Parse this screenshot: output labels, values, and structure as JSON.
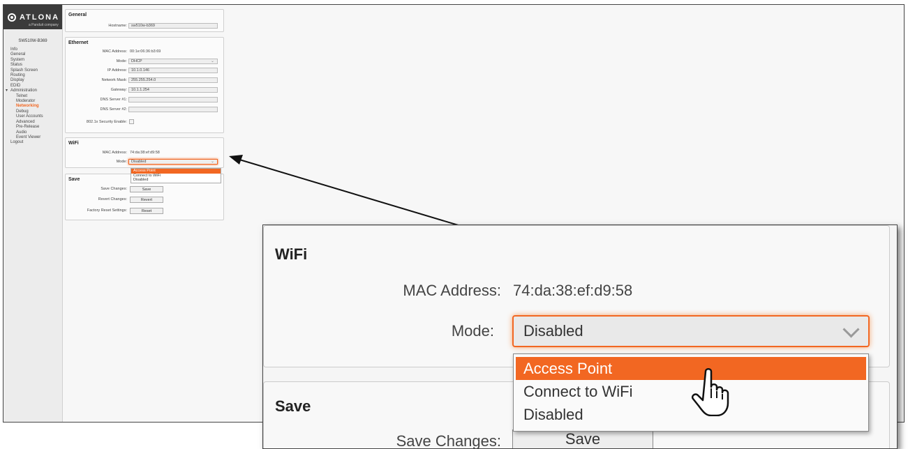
{
  "sidebar": {
    "logo_text": "ATLONA",
    "logo_sub": "a Panduit company",
    "device_name": "SW510W-B369",
    "items": [
      {
        "label": "Info",
        "level": 0
      },
      {
        "label": "General",
        "level": 0
      },
      {
        "label": "System",
        "level": 0
      },
      {
        "label": "Status",
        "level": 0
      },
      {
        "label": "Splash Screen",
        "level": 0
      },
      {
        "label": "Routing",
        "level": 0
      },
      {
        "label": "Display",
        "level": 0
      },
      {
        "label": "EDID",
        "level": 0
      },
      {
        "label": "Administration",
        "level": 0
      },
      {
        "label": "Telnet",
        "level": 1
      },
      {
        "label": "Moderator",
        "level": 1
      },
      {
        "label": "Networking",
        "level": 1,
        "active": true
      },
      {
        "label": "Debug",
        "level": 1
      },
      {
        "label": "User Accounts",
        "level": 1
      },
      {
        "label": "Advanced",
        "level": 1
      },
      {
        "label": "Pre-Release",
        "level": 1
      },
      {
        "label": "Audio",
        "level": 1
      },
      {
        "label": "Event Viewer",
        "level": 1
      },
      {
        "label": "Logout",
        "level": 0
      }
    ]
  },
  "general": {
    "title": "General",
    "hostname_label": "Hostname:",
    "hostname_value": "sw510w-b369"
  },
  "ethernet": {
    "title": "Ethernet",
    "mac_label": "MAC Address:",
    "mac_value": "00:1e:06:36:b3:69",
    "mode_label": "Mode:",
    "mode_value": "DHCP",
    "ip_label": "IP Address:",
    "ip_value": "10.1.0.146",
    "mask_label": "Network Mask:",
    "mask_value": "255.255.254.0",
    "gateway_label": "Gateway:",
    "gateway_value": "10.1.1.254",
    "dns1_label": "DNS Server #1:",
    "dns1_value": "",
    "dns2_label": "DNS Server #2:",
    "dns2_value": "",
    "security_label": "802.1x Security Enable:"
  },
  "wifi": {
    "title": "WiFi",
    "mac_label": "MAC Address:",
    "mac_value": "74:da:38:ef:d9:58",
    "mode_label": "Mode:",
    "mode_value": "Disabled",
    "options": [
      "Access Point",
      "Connect to WiFi",
      "Disabled"
    ],
    "highlighted_option": "Access Point"
  },
  "save": {
    "title": "Save",
    "save_label": "Save Changes:",
    "save_button": "Save",
    "revert_label": "Revert Changes:",
    "revert_button": "Revert",
    "reset_label": "Factory Reset Settings:",
    "reset_button": "Reset"
  },
  "zoom": {
    "wifi_title": "WiFi",
    "mac_label": "MAC Address:",
    "mac_value": "74:da:38:ef:d9:58",
    "mode_label": "Mode:",
    "mode_value": "Disabled",
    "options": [
      "Access Point",
      "Connect to WiFi",
      "Disabled"
    ],
    "save_title": "Save",
    "save_label": "Save Changes:",
    "save_button": "Save"
  },
  "colors": {
    "accent": "#f26722",
    "sidebar_bg": "#ececec",
    "logo_bg": "#3b3b3b"
  }
}
